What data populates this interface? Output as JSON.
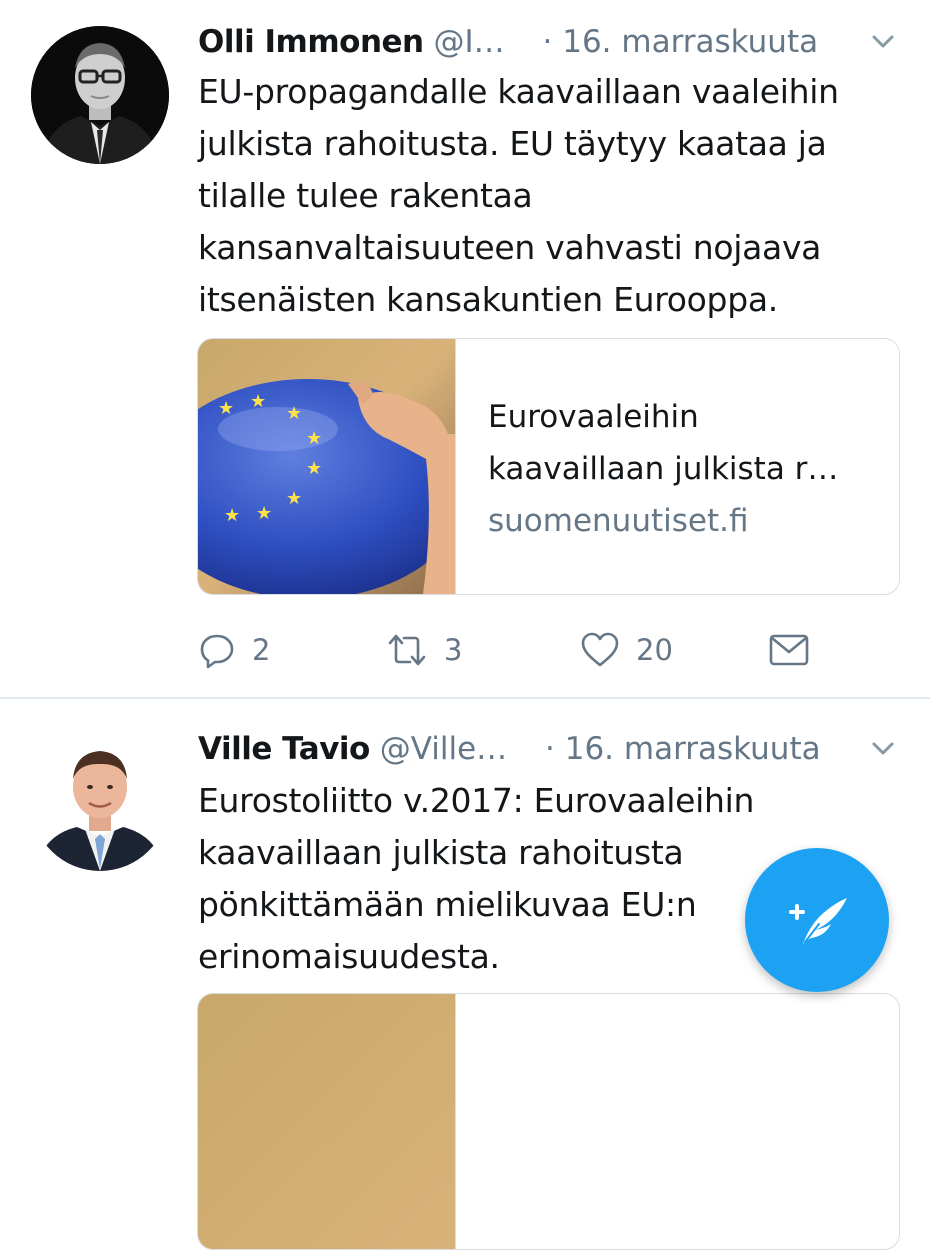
{
  "tweets": [
    {
      "author_name": "Olli Immonen",
      "handle": "@I…",
      "separator": "·",
      "date": "16. marraskuuta",
      "lines": [
        "EU-propagandalle kaavaillaan vaaleihin",
        "julkista rahoitusta. EU täytyy kaataa ja",
        "tilalle tulee rakentaa",
        "kansanvaltaisuuteen vahvasti nojaava",
        "itsenäisten kansakuntien Eurooppa."
      ],
      "card": {
        "title_lines": [
          "Eurovaaleihin",
          "kaavaillaan julkista r…"
        ],
        "domain": "suomenuutiset.fi"
      },
      "actions": {
        "reply_count": "2",
        "retweet_count": "3",
        "like_count": "20"
      }
    },
    {
      "author_name": "Ville Tavio",
      "handle": "@Ville…",
      "separator": "·",
      "date": "16. marraskuuta",
      "lines": [
        "Eurostoliitto v.2017: Eurovaaleihin",
        "kaavaillaan julkista rahoitusta",
        "pönkittämään mielikuvaa EU:n",
        "erinomaisuudesta."
      ]
    }
  ],
  "colors": {
    "primary_text": "#14171a",
    "secondary_text": "#657786",
    "accent": "#1da1f2",
    "divider": "#e1e8ed"
  },
  "icons": {
    "caret": "chevron-down-icon",
    "reply": "reply-icon",
    "retweet": "retweet-icon",
    "like": "heart-icon",
    "dm": "envelope-icon",
    "compose": "compose-tweet-icon"
  }
}
